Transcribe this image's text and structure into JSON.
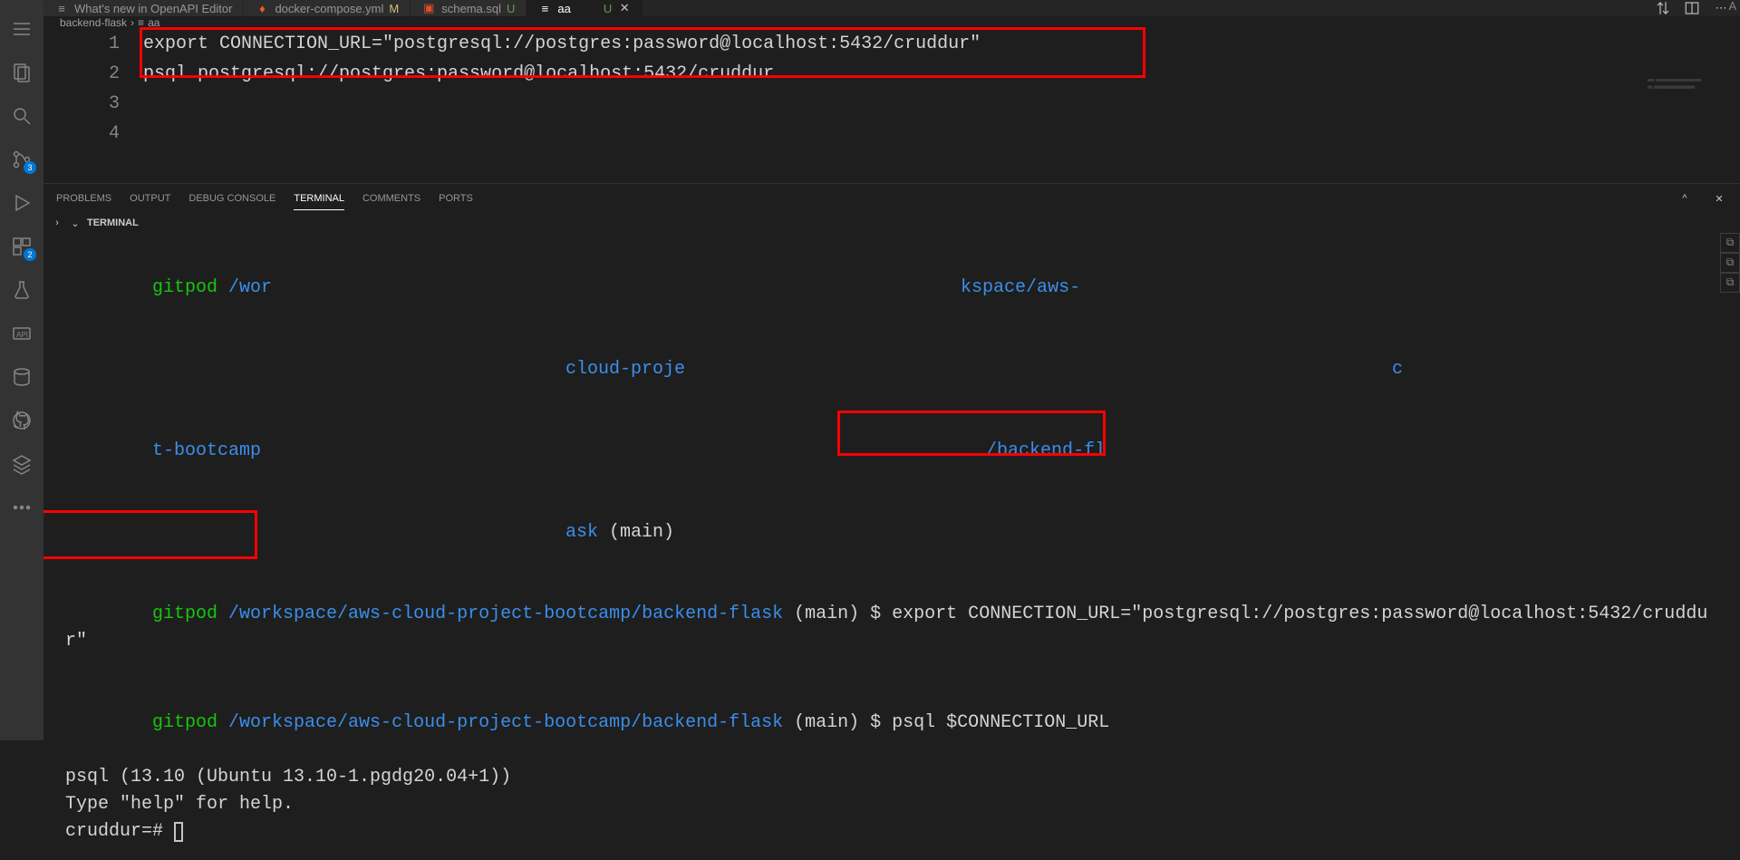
{
  "activity": {
    "source_control_badge": "3",
    "ext_badge": "2"
  },
  "tabs": [
    {
      "label": "What's new in OpenAPI Editor",
      "modified": "",
      "status": "",
      "icon": "lines"
    },
    {
      "label": "docker-compose.yml",
      "modified": "M",
      "status": "m",
      "icon": "flame"
    },
    {
      "label": "schema.sql",
      "modified": "U",
      "status": "u",
      "icon": "db"
    },
    {
      "label": "aa",
      "modified": "U",
      "status": "u active",
      "icon": "lines"
    }
  ],
  "breadcrumb": {
    "folder": "backend-flask",
    "file": "aa"
  },
  "editor": {
    "lines": [
      {
        "n": "1",
        "text": "export CONNECTION_URL=\"postgresql://postgres:password@localhost:5432/cruddur\""
      },
      {
        "n": "2",
        "text": ""
      },
      {
        "n": "3",
        "text": "psql postgresql://postgres:password@localhost:5432/cruddur"
      },
      {
        "n": "4",
        "text": ""
      }
    ]
  },
  "panel": {
    "tabs": {
      "problems": "PROBLEMS",
      "output": "OUTPUT",
      "debug": "DEBUG CONSOLE",
      "terminal": "TERMINAL",
      "comments": "COMMENTS",
      "ports": "PORTS"
    },
    "header": "TERMINAL"
  },
  "terminal": {
    "line1_pre": "gitpod",
    "line1_path_a": " /wor",
    "line1_path_b": "kspace/aws-",
    "line1_path_c": "cloud-proje",
    "line1_path_d": "c",
    "line1_path_e": "t-bootcamp",
    "line1_path_f": "/backend-fl",
    "line1_path_g": "ask",
    "line1_branch": " (main) ",
    "line2_pre": "gitpod",
    "line2_path": " /workspace/aws-cloud-project-bootcamp/backend-flask",
    "line2_branch": " (main) ",
    "line2_dollar": "$ ",
    "line2_cmd": "export CONNECTION_URL=\"postgresql://postgres:password@localhost:5432/cruddur\"",
    "line3_pre": "gitpod",
    "line3_path": " /workspace/aws-cloud-project-bootcamp/backend-flask",
    "line3_branch": " (main) ",
    "line3_dollar": "$ ",
    "line3_cmd": "psql $CONNECTION_URL",
    "line4": "psql (13.10 (Ubuntu 13.10-1.pgdg20.04+1))",
    "line5": "Type \"help\" for help.",
    "line6": "",
    "line7": "cruddur=# "
  }
}
